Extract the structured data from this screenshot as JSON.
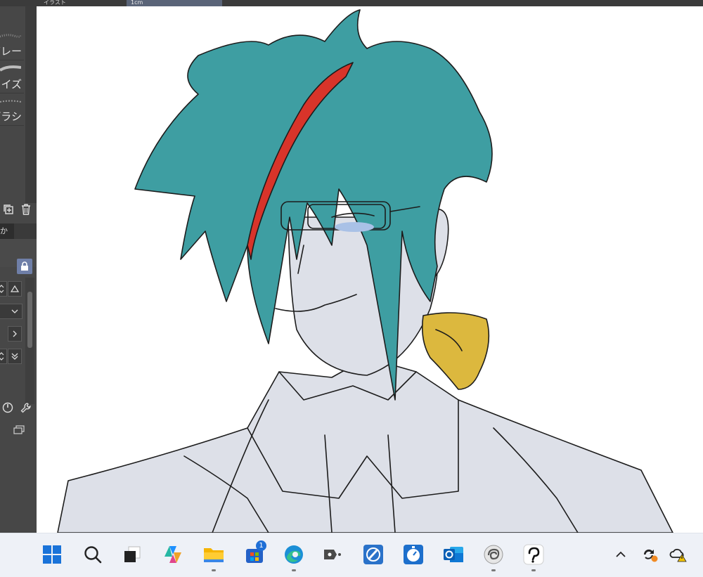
{
  "top_tabs": [
    "イラスト",
    "1cm"
  ],
  "brush_list": [
    {
      "label": "グレー"
    },
    {
      "label": "ノイズ"
    },
    {
      "label": "ブラシ"
    }
  ],
  "dock_tab_label": "か",
  "taskbar": {
    "items": [
      {
        "name": "start",
        "icon": "windows-logo",
        "running": false
      },
      {
        "name": "search",
        "icon": "search-icon",
        "running": false
      },
      {
        "name": "task-view",
        "icon": "task-view-icon",
        "running": false
      },
      {
        "name": "copilot",
        "icon": "copilot-icon",
        "running": false
      },
      {
        "name": "file-explorer",
        "icon": "folder-icon",
        "running": true
      },
      {
        "name": "microsoft-store",
        "icon": "store-icon",
        "running": false,
        "badge": "1"
      },
      {
        "name": "edge",
        "icon": "edge-icon",
        "running": true
      },
      {
        "name": "app-switch",
        "icon": "switch-icon",
        "running": false
      },
      {
        "name": "app-blue-1",
        "icon": "pen-app-icon",
        "running": false
      },
      {
        "name": "app-blue-2",
        "icon": "timer-app-icon",
        "running": false
      },
      {
        "name": "outlook",
        "icon": "outlook-icon",
        "running": false
      },
      {
        "name": "clip-studio",
        "icon": "clip-studio-icon",
        "running": true
      },
      {
        "name": "clip-studio-paint",
        "icon": "clip-studio-paint-icon",
        "running": true
      }
    ],
    "tray": [
      "chevron-up-icon",
      "sync-icon",
      "onedrive-warning-icon"
    ]
  },
  "colors": {
    "hair": "#3e9ea2",
    "hair_stripe": "#d8342a",
    "skin": "#dde0e8",
    "bow": "#dcb83e",
    "line": "#1c1c1c",
    "dock_bg": "#474747",
    "taskbar_bg": "#eef1f7",
    "lock_button": "#6f7fa8"
  }
}
